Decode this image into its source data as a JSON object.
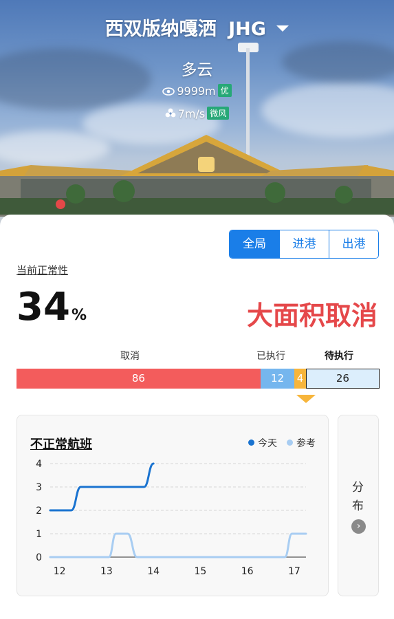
{
  "header": {
    "airport_name": "西双版纳嘎洒",
    "airport_code": "JHG",
    "weather": "多云",
    "visibility": "9999m",
    "visibility_level": "优",
    "wind_speed": "7m/s",
    "wind_level": "微风",
    "icons": [
      "eye-icon",
      "fan-icon",
      "chevron-down-icon"
    ]
  },
  "tabs": [
    {
      "label": "全局",
      "active": true
    },
    {
      "label": "进港",
      "active": false
    },
    {
      "label": "出港",
      "active": false
    }
  ],
  "summary": {
    "normal_label": "当前正常性",
    "percent": "34",
    "percent_unit": "%",
    "status_text": "大面积取消"
  },
  "flight_bar": {
    "labels": {
      "cancelled": "取消",
      "executed": "已执行",
      "pending": "待执行"
    },
    "cancelled": 86,
    "executed": 12,
    "current": 4,
    "pending": 26,
    "colors": {
      "cancelled": "#f35c5c",
      "executed": "#75b6ee",
      "current": "#f7b53b",
      "pending": "#dceefc"
    }
  },
  "chart_panel": {
    "title": "不正常航班",
    "legend": [
      {
        "name": "今天",
        "color": "#1a73d0"
      },
      {
        "name": "参考",
        "color": "#a8cdf2"
      }
    ]
  },
  "chart_data": {
    "type": "line",
    "x_ticks": [
      "12",
      "13",
      "14",
      "15",
      "16",
      "17"
    ],
    "y_ticks": [
      "0",
      "1",
      "2",
      "3",
      "4"
    ],
    "ylim": [
      0,
      4
    ],
    "xlim": [
      11.8,
      17.25
    ],
    "series": [
      {
        "name": "今天",
        "color": "#1a73d0",
        "points": [
          [
            11.8,
            2
          ],
          [
            12.25,
            2
          ],
          [
            12.45,
            3
          ],
          [
            13.8,
            3
          ],
          [
            14.0,
            4
          ]
        ]
      },
      {
        "name": "参考",
        "color": "#a8cdf2",
        "points": [
          [
            11.8,
            0
          ],
          [
            13.05,
            0
          ],
          [
            13.2,
            1
          ],
          [
            13.45,
            1
          ],
          [
            13.65,
            0
          ],
          [
            16.8,
            0
          ],
          [
            16.95,
            1
          ],
          [
            17.25,
            1
          ]
        ]
      }
    ],
    "grid": true
  },
  "side_panel": {
    "label_line1": "分",
    "label_line2": "布",
    "arrow": "›"
  }
}
